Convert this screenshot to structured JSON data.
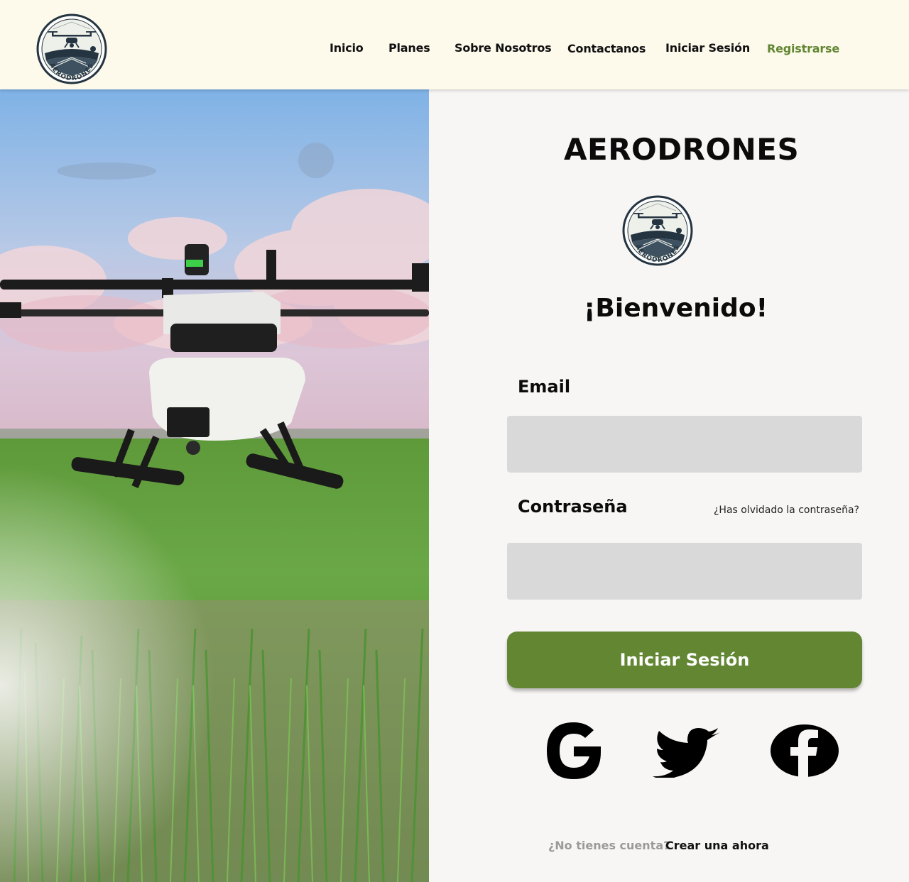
{
  "header": {
    "logo_text": "AERODRONES",
    "nav": [
      {
        "label": "Inicio"
      },
      {
        "label": "Planes"
      },
      {
        "label": "Sobre Nosotros"
      },
      {
        "label": "Contactanos"
      },
      {
        "label": "Iniciar Sesión"
      },
      {
        "label": "Registrarse"
      }
    ]
  },
  "hero": {
    "image": "agricultural-drone-over-rice-field"
  },
  "login": {
    "brand": "AERODRONES",
    "welcome": "¡Bienvenido!",
    "email_label": "Email",
    "email_value": "",
    "password_label": "Contraseña",
    "password_value": "",
    "forgot_password": "¿Has olvidado la contraseña?",
    "submit_label": "Iniciar Sesión",
    "social": [
      {
        "name": "google",
        "icon": "google-icon"
      },
      {
        "name": "twitter",
        "icon": "twitter-icon"
      },
      {
        "name": "facebook",
        "icon": "facebook-icon"
      }
    ],
    "no_account": "¿No tienes cuenta?",
    "create_account": "Crear una ahora"
  },
  "colors": {
    "header_bg": "#fdfaec",
    "accent_green": "#628632",
    "input_bg": "#d9d9d9",
    "panel_bg": "#f7f6f4",
    "logo_navy": "#1f2e3a"
  }
}
